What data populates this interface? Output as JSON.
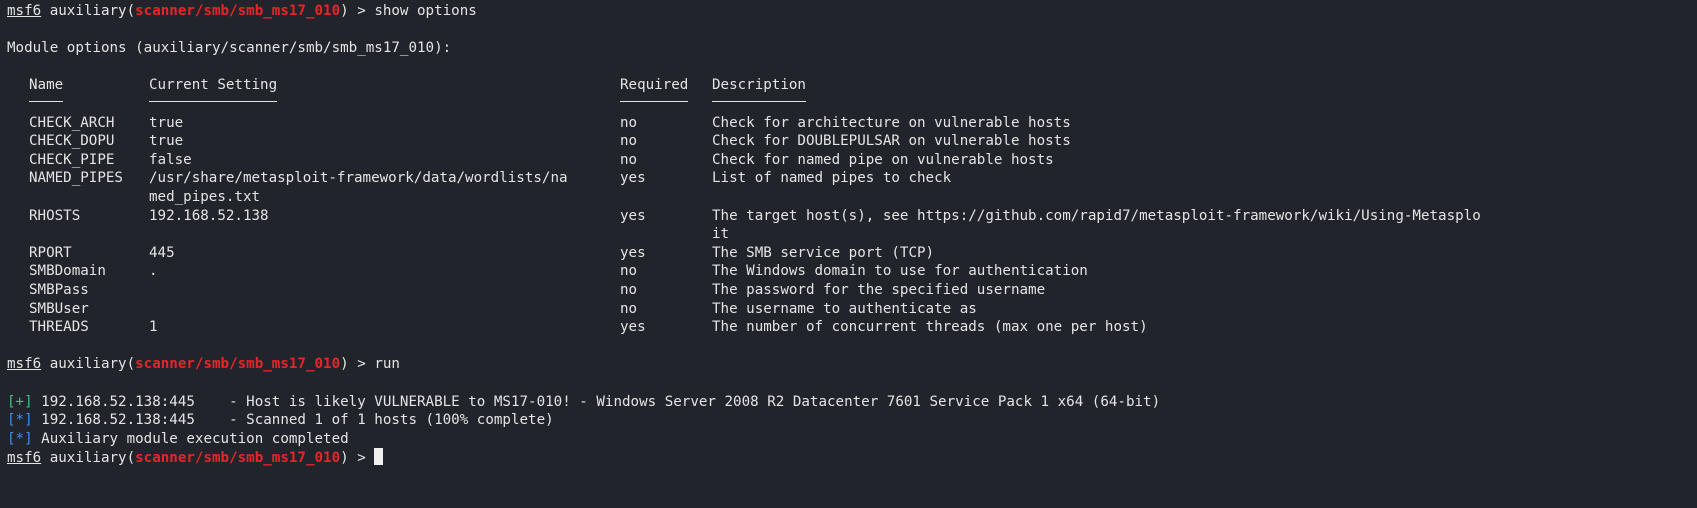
{
  "prompt": {
    "app": "msf6",
    "prefix": " auxiliary(",
    "module": "scanner/smb/smb_ms17_010",
    "suffix": ") > "
  },
  "commands": [
    "show options",
    "run"
  ],
  "module_options_title": "Module options (auxiliary/scanner/smb/smb_ms17_010):",
  "table": {
    "headers": [
      "Name",
      "Current Setting",
      "Required",
      "Description"
    ],
    "rows": [
      {
        "name": "CHECK_ARCH",
        "value": "true",
        "required": "no",
        "desc": "Check for architecture on vulnerable hosts"
      },
      {
        "name": "CHECK_DOPU",
        "value": "true",
        "required": "no",
        "desc": "Check for DOUBLEPULSAR on vulnerable hosts"
      },
      {
        "name": "CHECK_PIPE",
        "value": "false",
        "required": "no",
        "desc": "Check for named pipe on vulnerable hosts"
      },
      {
        "name": "NAMED_PIPES",
        "value": "/usr/share/metasploit-framework/data/wordlists/na",
        "value_cont": "med_pipes.txt",
        "required": "yes",
        "desc": "List of named pipes to check"
      },
      {
        "name": "RHOSTS",
        "value": "192.168.52.138",
        "required": "yes",
        "desc": "The target host(s), see https://github.com/rapid7/metasploit-framework/wiki/Using-Metasplo",
        "desc_cont": "it"
      },
      {
        "name": "RPORT",
        "value": "445",
        "required": "yes",
        "desc": "The SMB service port (TCP)"
      },
      {
        "name": "SMBDomain",
        "value": ".",
        "required": "no",
        "desc": "The Windows domain to use for authentication"
      },
      {
        "name": "SMBPass",
        "value": "",
        "required": "no",
        "desc": "The password for the specified username"
      },
      {
        "name": "SMBUser",
        "value": "",
        "required": "no",
        "desc": "The username to authenticate as"
      },
      {
        "name": "THREADS",
        "value": "1",
        "required": "yes",
        "desc": "The number of concurrent threads (max one per host)"
      }
    ]
  },
  "output": [
    {
      "tag": "[+]",
      "text": " 192.168.52.138:445    - Host is likely VULNERABLE to MS17-010! - Windows Server 2008 R2 Datacenter 7601 Service Pack 1 x64 (64-bit)"
    },
    {
      "tag": "[*]",
      "text": " 192.168.52.138:445    - Scanned 1 of 1 hosts (100% complete)"
    },
    {
      "tag": "[*]",
      "text": " Auxiliary module execution completed"
    }
  ],
  "colors": {
    "background": "#22242c",
    "module": "#e8242a",
    "success": "#3fc08a",
    "info": "#3d8ef0"
  }
}
